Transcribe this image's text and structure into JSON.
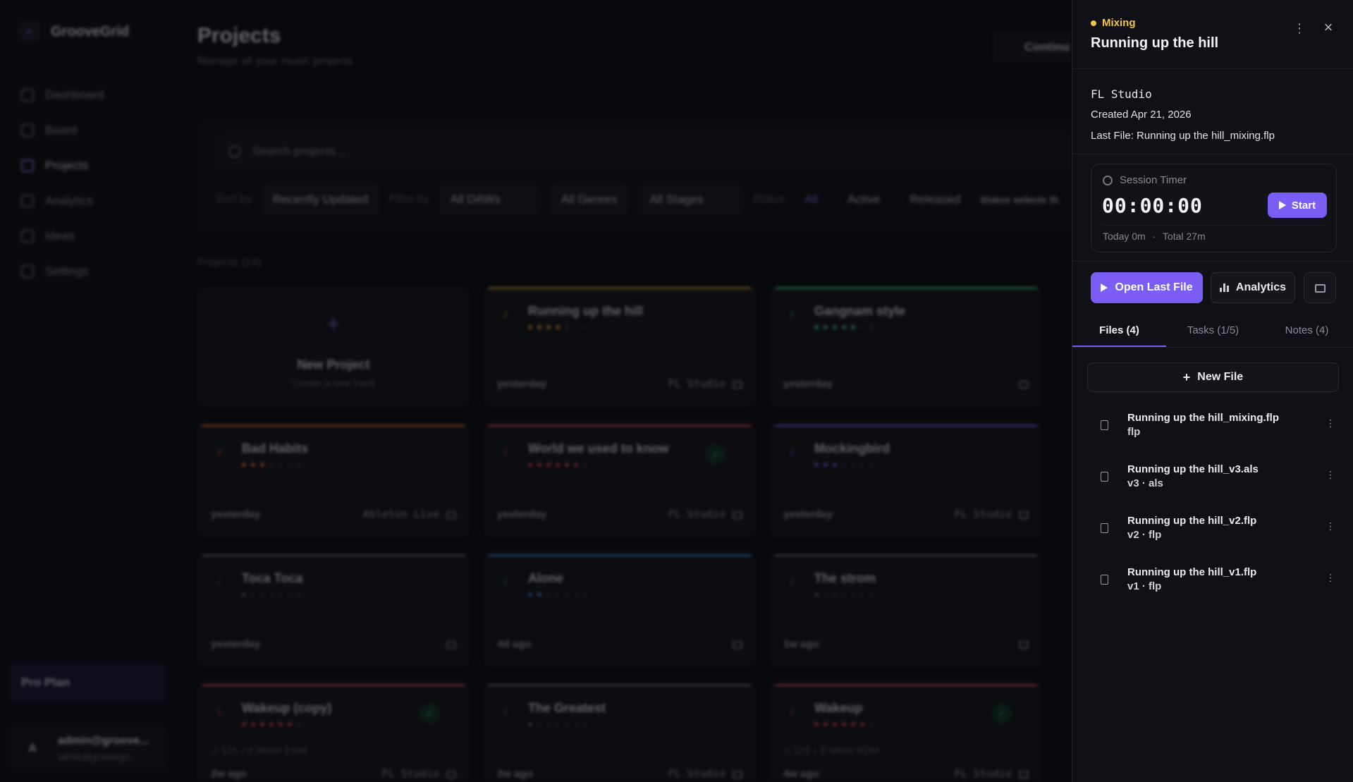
{
  "app": {
    "name": "GrooveGrid",
    "logo_mark": "••"
  },
  "sidebar": {
    "items": [
      {
        "label": "Dashboard",
        "icon": "grid-icon"
      },
      {
        "label": "Board",
        "icon": "kanban-icon"
      },
      {
        "label": "Projects",
        "icon": "folder-icon",
        "active": true
      },
      {
        "label": "Analytics",
        "icon": "bar-chart-icon"
      },
      {
        "label": "Ideas",
        "icon": "lightbulb-icon"
      },
      {
        "label": "Settings",
        "icon": "gear-icon"
      }
    ],
    "plan": "Pro Plan",
    "user": {
      "avatar": "A",
      "name": "admin@groove...",
      "email": "admin@groovegri..."
    }
  },
  "main": {
    "title": "Projects",
    "subtitle": "Manage all your music projects",
    "continue_label": "Continu",
    "search_placeholder": "Search projects...",
    "sort_label": "Sort by",
    "sort_value": "Recently Updated",
    "filter_label": "Filter by",
    "daw_filter": "All DAWs",
    "genre_filter": "All Genres",
    "stage_filter": "All Stages",
    "status_label": "Status",
    "status_options": [
      "All",
      "Active",
      "Released"
    ],
    "status_hint": "Status selects th",
    "projects_count": "Projects (14)",
    "new_project": {
      "title": "New Project",
      "subtitle": "Create a new track"
    },
    "cards": [
      {
        "title": "Running up the hill",
        "date": "yesterday",
        "daw": "FL Studio",
        "color": "#e0a030",
        "dots": 4
      },
      {
        "title": "Gangnam style",
        "date": "yesterday",
        "daw": "",
        "color": "#3ecf8e",
        "dots": 5
      },
      {
        "title": "Bad Habits",
        "date": "yesterday",
        "daw": "Ableton Live",
        "color": "#ef7a3a",
        "dots": 3
      },
      {
        "title": "World we used to know",
        "date": "yesterday",
        "daw": "FL Studio",
        "color": "#e84560",
        "dots": 6,
        "released": true
      },
      {
        "title": "Mockingbird",
        "date": "yesterday",
        "daw": "FL Studio",
        "color": "#7b5cf5",
        "dots": 3
      },
      {
        "title": "Toca Toca",
        "date": "yesterday",
        "daw": "",
        "color": "#6e6e7a",
        "dots": 1
      },
      {
        "title": "Alone",
        "date": "4d ago",
        "daw": "",
        "color": "#3a8ee8",
        "dots": 2
      },
      {
        "title": "The strom",
        "date": "1w ago",
        "daw": "",
        "color": "#6e6e7a",
        "dots": 1
      },
      {
        "title": "Wakeup (copy)",
        "date": "2w ago",
        "daw": "FL Studio",
        "color": "#e84560",
        "dots": 6,
        "released": true,
        "meta": "♫ 123  ♪ E Minor  EDM"
      },
      {
        "title": "The Greatest",
        "date": "2w ago",
        "daw": "FL Studio",
        "color": "#6e6e7a",
        "dots": 1
      },
      {
        "title": "Wakeup",
        "date": "4w ago",
        "daw": "FL Studio",
        "color": "#e84560",
        "dots": 6,
        "released": true,
        "meta": "♫ 123  ♪ E Minor  EDM"
      }
    ]
  },
  "drawer": {
    "status": "Mixing",
    "status_color": "#f0c545",
    "title": "Running up the hill",
    "daw": "FL Studio",
    "created": "Created Apr 21, 2026",
    "last_file": "Last File: Running up the hill_mixing.flp",
    "timer": {
      "label": "Session Timer",
      "time": "00:00:00",
      "start_label": "Start",
      "today": "Today 0m",
      "sep": "·",
      "total": "Total 27m"
    },
    "actions": {
      "open_last_file": "Open Last File",
      "analytics": "Analytics"
    },
    "tabs": [
      "Files (4)",
      "Tasks (1/5)",
      "Notes (4)"
    ],
    "new_file_label": "New File",
    "files": [
      {
        "name": "Running up the hill_mixing.flp",
        "meta": "flp"
      },
      {
        "name": "Running up the hill_v3.als",
        "meta": "v3 · als"
      },
      {
        "name": "Running up the hill_v2.flp",
        "meta": "v2 · flp"
      },
      {
        "name": "Running up the hill_v1.flp",
        "meta": "v1 · flp"
      }
    ],
    "accent": "#7b5cf5"
  }
}
